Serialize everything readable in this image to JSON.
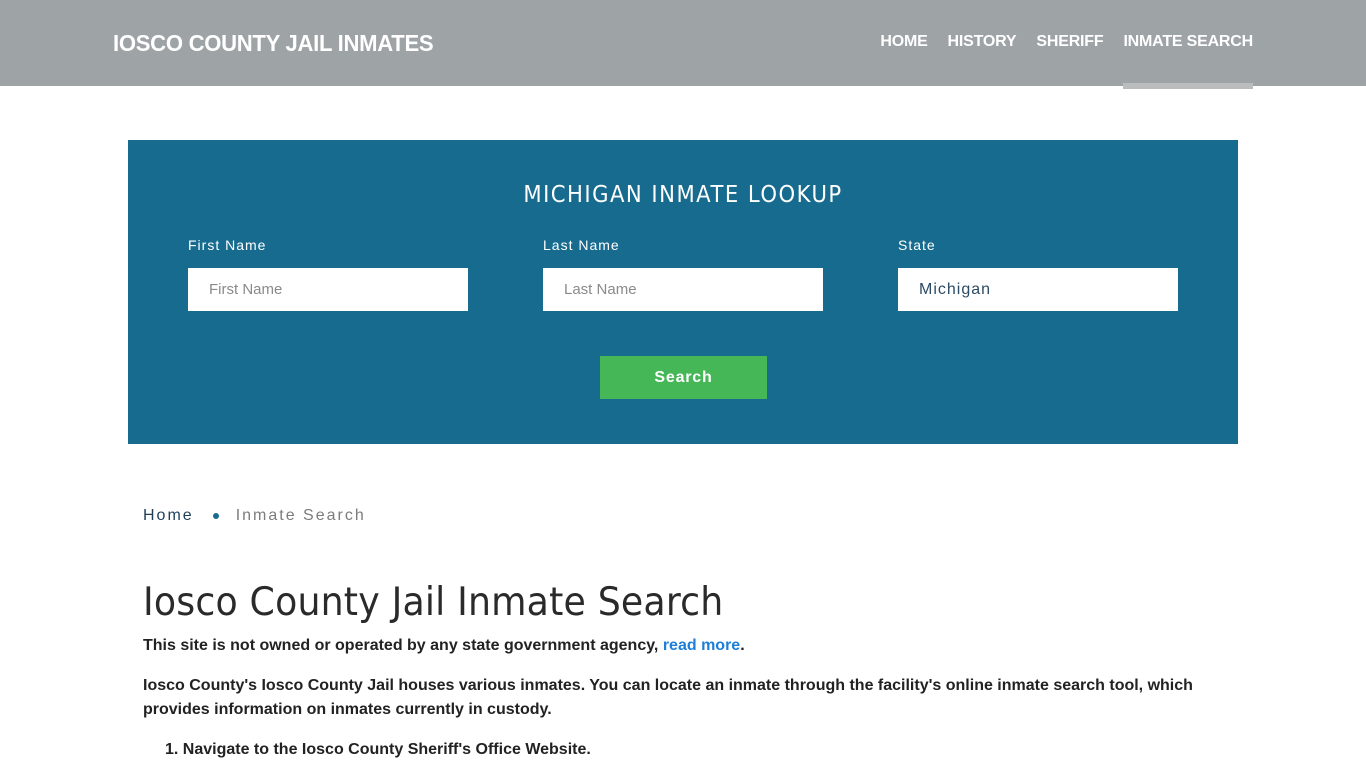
{
  "header": {
    "brand": "IOSCO COUNTY JAIL INMATES",
    "nav": [
      {
        "label": "HOME",
        "active": false
      },
      {
        "label": "HISTORY",
        "active": false
      },
      {
        "label": "SHERIFF",
        "active": false
      },
      {
        "label": "INMATE SEARCH",
        "active": true
      }
    ]
  },
  "search_panel": {
    "title": "MICHIGAN INMATE LOOKUP",
    "first_name": {
      "label": "First Name",
      "placeholder": "First Name",
      "value": ""
    },
    "last_name": {
      "label": "Last Name",
      "placeholder": "Last Name",
      "value": ""
    },
    "state": {
      "label": "State",
      "value": "Michigan"
    },
    "search_button": "Search",
    "colors": {
      "panel": "#176b8f",
      "button": "#45b757"
    }
  },
  "breadcrumb": {
    "home": "Home",
    "current": "Inmate Search"
  },
  "content": {
    "title": "Iosco County Jail Inmate Search",
    "disclaimer_text": "This site is not owned or operated by any state government agency, ",
    "disclaimer_link": "read more",
    "disclaimer_end": ".",
    "paragraph": "Iosco County's Iosco County Jail houses various inmates. You can locate an inmate through the facility's online inmate search tool, which provides information on inmates currently in custody.",
    "steps": [
      "1. Navigate to the Iosco County Sheriff's Office Website."
    ]
  }
}
